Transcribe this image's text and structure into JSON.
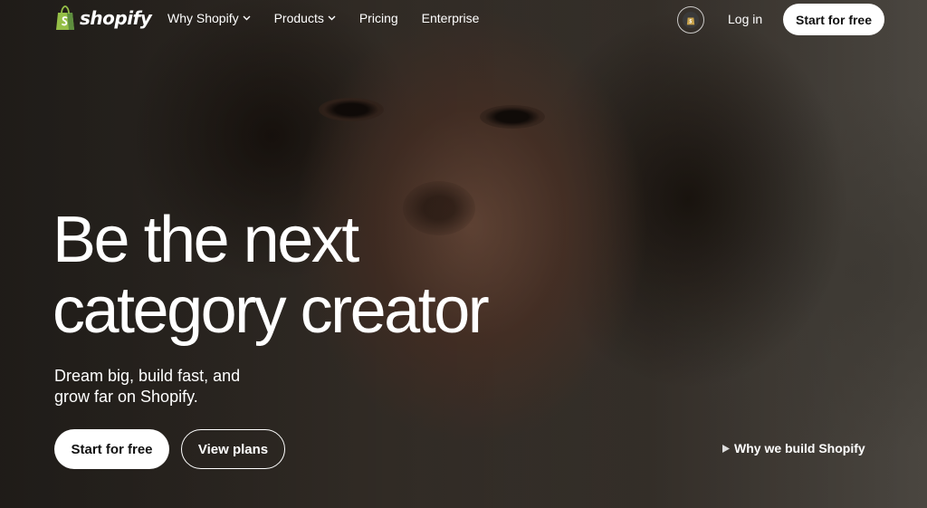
{
  "brand": {
    "name": "shopify",
    "logo_icon": "shopify-bag-icon",
    "accent_color": "#95BF47"
  },
  "nav": {
    "links": [
      {
        "label": "Why Shopify",
        "dropdown": true
      },
      {
        "label": "Products",
        "dropdown": true
      },
      {
        "label": "Pricing",
        "dropdown": false
      },
      {
        "label": "Enterprise",
        "dropdown": false
      }
    ],
    "region_icon": "shopify-bag-icon",
    "login_label": "Log in",
    "start_label": "Start for free"
  },
  "hero": {
    "headline_line1": "Be the next",
    "headline_line2": "category creator",
    "subhead": "Dream big, build fast, and grow far on Shopify.",
    "primary_cta": "Start for free",
    "secondary_cta": "View plans",
    "video_link": "Why we build Shopify",
    "video_icon": "play-icon"
  }
}
